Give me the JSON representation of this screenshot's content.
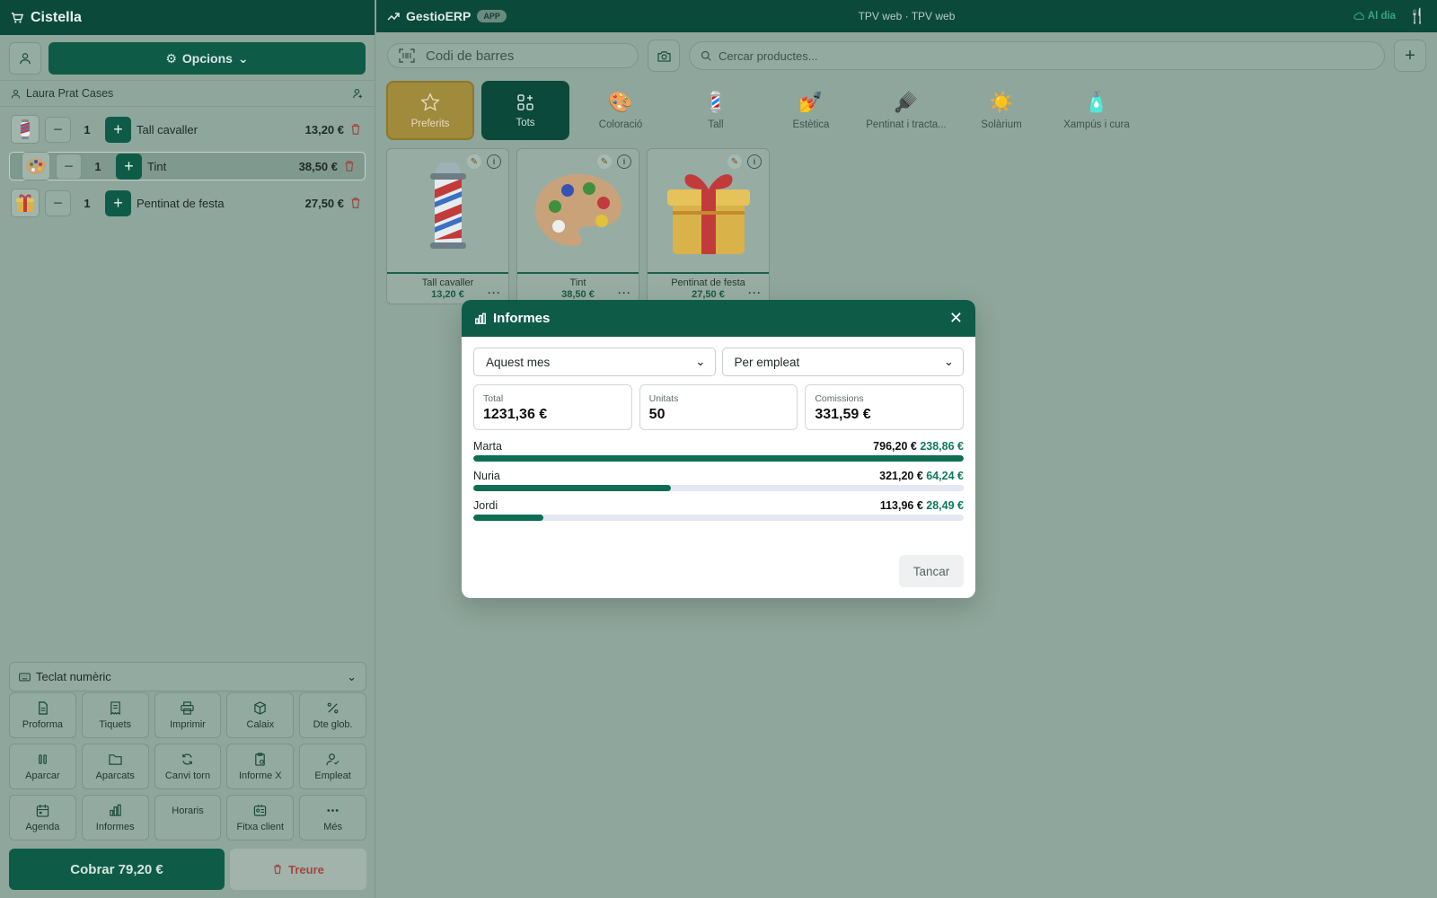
{
  "cart": {
    "title": "Cistella",
    "options_label": "Opcions",
    "client_name": "Laura Prat Cases",
    "items": [
      {
        "name": "Tall cavaller",
        "qty": "1",
        "price": "13,20 €",
        "icon": "barber-pole-icon"
      },
      {
        "name": "Tint",
        "qty": "1",
        "price": "38,50 €",
        "icon": "palette-icon"
      },
      {
        "name": "Pentinat de festa",
        "qty": "1",
        "price": "27,50 €",
        "icon": "gift-icon"
      }
    ],
    "keypad_label": "Teclat numèric",
    "actions": [
      "Proforma",
      "Tiquets",
      "Imprimir",
      "Calaix",
      "Dte glob.",
      "Aparcar",
      "Aparcats",
      "Canvi torn",
      "Informe X",
      "Empleat",
      "Agenda",
      "Informes",
      "Horaris",
      "Fitxa client",
      "Més"
    ],
    "pay_label": "Cobrar  79,20 €",
    "remove_label": "Treure"
  },
  "topbar": {
    "brand": "GestioERP",
    "badge": "APP",
    "center": "TPV web · TPV web",
    "sync": "Al dia"
  },
  "search": {
    "barcode_placeholder": "Codi de barres",
    "product_placeholder": "Cercar productes..."
  },
  "categories": [
    "Preferits",
    "Tots",
    "Coloració",
    "Tall",
    "Estètica",
    "Pentinat i tracta...",
    "Solàrium",
    "Xampús i cura"
  ],
  "products": [
    {
      "name": "Tall cavaller",
      "price": "13,20 €"
    },
    {
      "name": "Tint",
      "price": "38,50 €"
    },
    {
      "name": "Pentinat de festa",
      "price": "27,50 €"
    }
  ],
  "modal": {
    "title": "Informes",
    "period": "Aquest mes",
    "group_by": "Per empleat",
    "stats": [
      {
        "label": "Total",
        "value": "1231,36 €"
      },
      {
        "label": "Unitats",
        "value": "50"
      },
      {
        "label": "Comissions",
        "value": "331,59 €"
      }
    ],
    "employees": [
      {
        "name": "Marta",
        "amount": "796,20 €",
        "commission": "238,86 €",
        "share": 1.0
      },
      {
        "name": "Nuria",
        "amount": "321,20 €",
        "commission": "64,24 €",
        "share": 0.403
      },
      {
        "name": "Jordi",
        "amount": "113,96 €",
        "commission": "28,49 €",
        "share": 0.143
      }
    ],
    "close_label": "Tancar"
  },
  "colors": {
    "primary": "#0e5c48",
    "accent": "#0e7a5c",
    "favorite": "#a08a3b"
  }
}
